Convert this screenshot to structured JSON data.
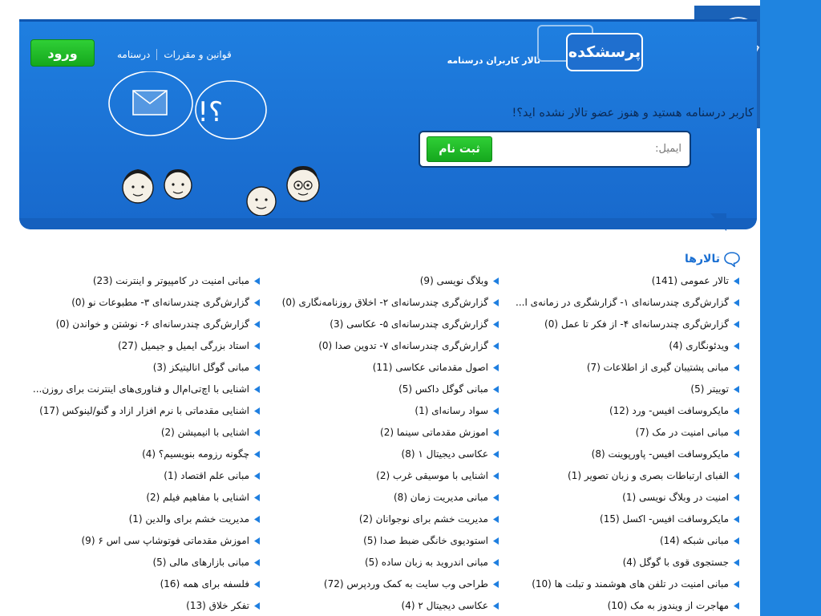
{
  "header": {
    "logo_text": "پرسشکده",
    "tagline": "تالار کاربران درسنامه",
    "nav": [
      {
        "label": "قوانین و مقررات"
      },
      {
        "label": "درسنامه"
      }
    ],
    "login_label": "ورود",
    "register": {
      "question": "کاربر درسنامه هستید و هنوز عضو تالار نشده اید؟!",
      "email_label": "ایمیل:",
      "email_value": "",
      "button_label": "ثبت نام"
    }
  },
  "forums": {
    "title": "تالارها",
    "columns": [
      [
        "تالار عمومی (141)",
        "گزارش‌گری چندرسانه‌ای ۱- گزارشگری در زمانه‌ی ا...",
        "گزارش‌گری چندرسانه‌ای ۴- از فکر تا عمل (0)",
        "ویدئونگاری (4)",
        "مبانی پشتیبان گیری از اطلاعات (7)",
        "توییتر (5)",
        "مایکروسافت افیس- ورد (12)",
        "مبانی امنیت در مک (7)",
        "مایکروسافت افیس- پاورپوینت (8)",
        "الفبای ارتباطات بصری و زبان تصویر (1)",
        "امنیت در وبلاگ نویسی (1)",
        "مایکروسافت افیس- اکسل (15)",
        "مبانی شبکه (14)",
        "جستجوی قوی با گوگل (4)",
        "مبانی امنیت در تلفن های هوشمند و تبلت ها (10)",
        "مهاجرت از ویندوز به مک (10)"
      ],
      [
        "وبلاگ نویسی (9)",
        "گزارش‌گری چندرسانه‌ای ۲- اخلاق روزنامه‌نگاری (0)",
        "گزارش‌گری چندرسانه‌ای ۵- عکاسی (3)",
        "گزارش‌گری چندرسانه‌ای ۷- تدوین صدا (0)",
        "اصول مقدماتی عکاسی (11)",
        "مبانی گوگل داکس (5)",
        "سواد رسانه‌ای (1)",
        "اموزش مقدماتی سینما (2)",
        "عکاسی دیجیتال ۱ (8)",
        "اشنایی با موسیقی غرب (2)",
        "مبانی مدیریت زمان (8)",
        "مدیریت خشم برای نوجوانان (2)",
        "استودیوی خانگی ضبط صدا (5)",
        "مبانی اندروید به زبان ساده (5)",
        "طراحی وب سایت به کمک وردپرس (72)",
        "عکاسی دیجیتال ۲ (4)"
      ],
      [
        "مبانی امنیت در کامپیوتر و اینترنت (23)",
        "گزارش‌گری چندرسانه‌ای ۳- مطبوعات نو (0)",
        "گزارش‌گری چندرسانه‌ای ۶- نوشتن و خواندن (0)",
        "استاد بزرگی ایمیل و جیمیل (27)",
        "مبانی گوگل انالیتیکز (3)",
        "اشنایی با اچ‌تی‌ام‌ال و فناوری‌های اینترنت برای روزن...",
        "اشنایی مقدماتی با نرم افزار ازاد و گنو/لینوکس (17)",
        "اشنایی با انیمیشن (2)",
        "چگونه رزومه بنویسیم؟ (4)",
        "مبانی علم اقتصاد (1)",
        "اشنایی با مفاهیم فیلم (2)",
        "مدیریت خشم برای والدین (1)",
        "اموزش مقدماتی فوتوشاپ سی اس ۶ (9)",
        "مبانی بازارهای مالی (5)",
        "فلسفه برای همه (16)",
        "تفکر خلاق (13)"
      ]
    ]
  },
  "colors": {
    "banner_blue": "#1f7fe0",
    "green_button": "#15a81d",
    "link_blue": "#1a6fd2"
  }
}
